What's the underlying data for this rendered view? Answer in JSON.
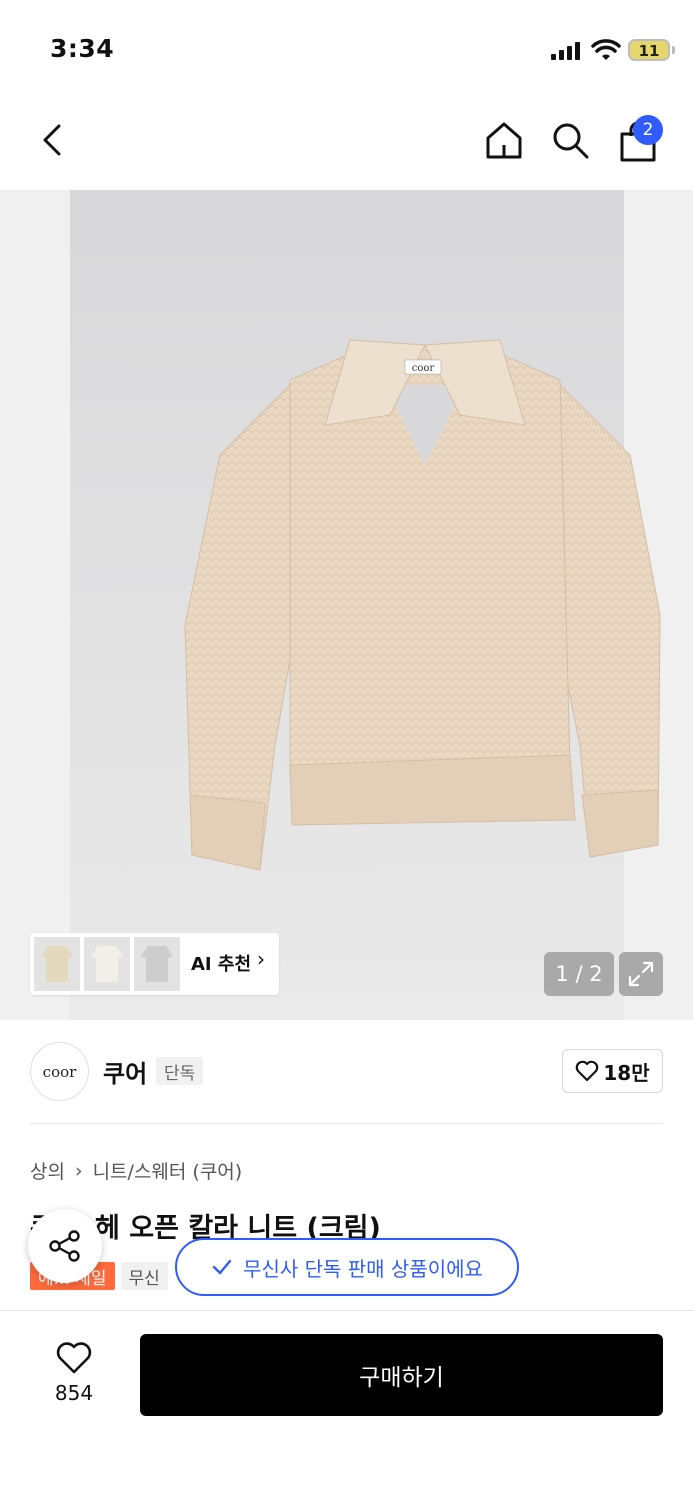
{
  "status_bar": {
    "time": "3:34",
    "battery": "11"
  },
  "nav": {
    "cart_count": "2"
  },
  "gallery": {
    "thumbs_ai_label": "AI 추천",
    "page_counter": "1 / 2",
    "product_logo_text": "coor"
  },
  "brand": {
    "logo_text": "coor",
    "name": "쿠어",
    "exclusive_tag": "단독",
    "likes": "18만"
  },
  "breadcrumb": {
    "category": "상의",
    "subcategory": "니트/스웨터 (쿠어)"
  },
  "product": {
    "title": "쿠... 헤 오픈 칼라 니트 (크림)",
    "sale_tag": "에... 세일",
    "gray_tag": "무신"
  },
  "toast": {
    "message": "무신사 단독 판매 상품이에요"
  },
  "bottom_bar": {
    "wish_count": "854",
    "buy_label": "구매하기"
  },
  "colors": {
    "accent": "#2f5bff",
    "sale": "#ff6a3d",
    "buy_button": "#000000"
  }
}
